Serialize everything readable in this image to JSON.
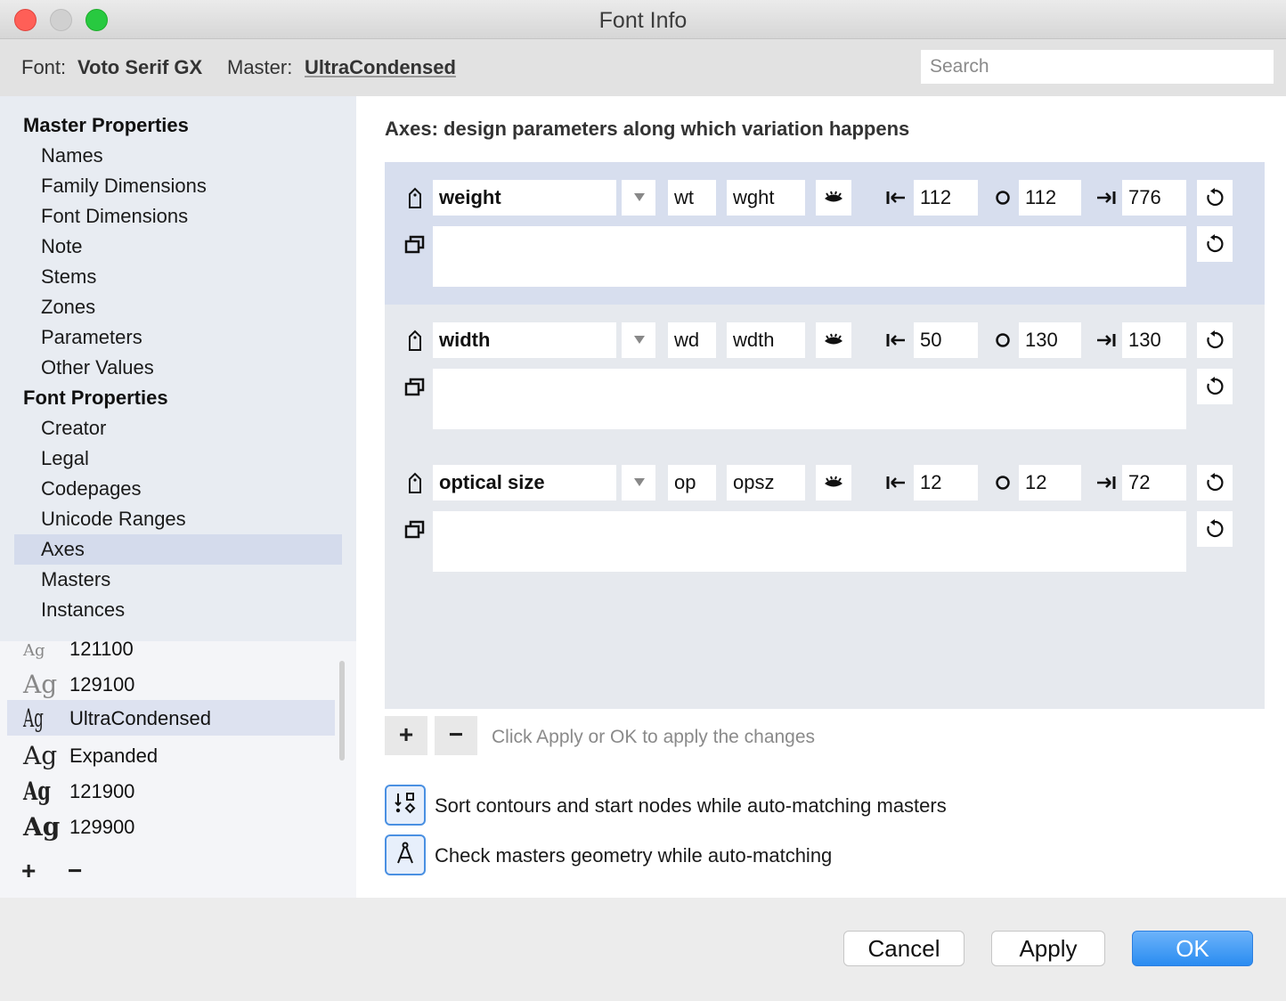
{
  "window": {
    "title": "Font Info"
  },
  "header": {
    "font_label": "Font:",
    "font_name": "Voto Serif GX",
    "master_label": "Master:",
    "master_name": "UltraCondensed",
    "search_placeholder": "Search"
  },
  "sidebar": {
    "master_properties": {
      "heading": "Master Properties",
      "items": [
        "Names",
        "Family Dimensions",
        "Font Dimensions",
        "Note",
        "Stems",
        "Zones",
        "Parameters",
        "Other Values"
      ]
    },
    "font_properties": {
      "heading": "Font Properties",
      "items": [
        "Creator",
        "Legal",
        "Codepages",
        "Unicode Ranges",
        "Axes",
        "Masters",
        "Instances"
      ],
      "selected": "Axes"
    }
  },
  "masters": {
    "sample": "Ag",
    "items": [
      "121100",
      "129100",
      "UltraCondensed",
      "Expanded",
      "121900",
      "129900"
    ],
    "selected": "UltraCondensed",
    "add_label": "+",
    "remove_label": "−"
  },
  "main": {
    "title": "Axes: design parameters along which variation happens",
    "axes": [
      {
        "name": "weight",
        "short": "wt",
        "tag": "wght",
        "min": "112",
        "default": "112",
        "max": "776"
      },
      {
        "name": "width",
        "short": "wd",
        "tag": "wdth",
        "min": "50",
        "default": "130",
        "max": "130"
      },
      {
        "name": "optical size",
        "short": "op",
        "tag": "opsz",
        "min": "12",
        "default": "12",
        "max": "72"
      }
    ],
    "add_label": "+",
    "remove_label": "−",
    "hint": "Click Apply or OK to apply the changes",
    "options": [
      {
        "label": "Sort contours and start nodes while auto-matching masters",
        "icon": "sort-contours-icon"
      },
      {
        "label": "Check masters geometry while auto-matching",
        "icon": "compass-icon"
      }
    ]
  },
  "footer": {
    "cancel": "Cancel",
    "apply": "Apply",
    "ok": "OK"
  },
  "colors": {
    "accent": "#2a8cf1",
    "selection": "#d4dbec",
    "close": "#ff5f57",
    "maximize": "#28c940"
  }
}
